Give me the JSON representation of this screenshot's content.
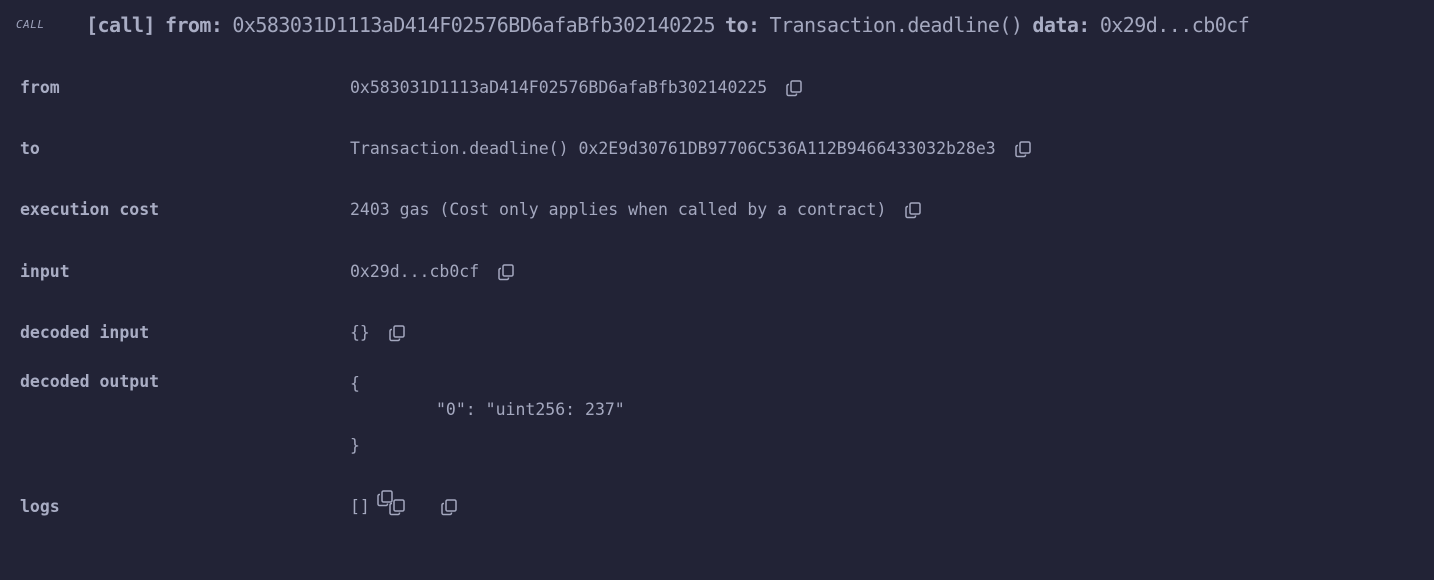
{
  "header": {
    "badge": "CALL",
    "call_tag": "[call]",
    "from_kw": "from:",
    "from_val": "0x583031D1113aD414F02576BD6afaBfb302140225",
    "to_kw": "to:",
    "to_val": "Transaction.deadline()",
    "data_kw": "data:",
    "data_val": "0x29d...cb0cf"
  },
  "rows": {
    "from": {
      "label": "from",
      "value": "0x583031D1113aD414F02576BD6afaBfb302140225"
    },
    "to": {
      "label": "to",
      "value": "Transaction.deadline() 0x2E9d30761DB97706C536A112B9466433032b28e3"
    },
    "execution_cost": {
      "label": "execution cost",
      "value": "2403 gas (Cost only applies when called by a contract)"
    },
    "input": {
      "label": "input",
      "value": "0x29d...cb0cf"
    },
    "decoded_input": {
      "label": "decoded input",
      "value": "{}"
    },
    "decoded_output": {
      "label": "decoded output",
      "open": "{",
      "line": "\"0\": \"uint256: 237\"",
      "close": "}"
    },
    "logs": {
      "label": "logs",
      "value": "[]"
    }
  },
  "icons": {
    "copy": "copy-icon"
  }
}
